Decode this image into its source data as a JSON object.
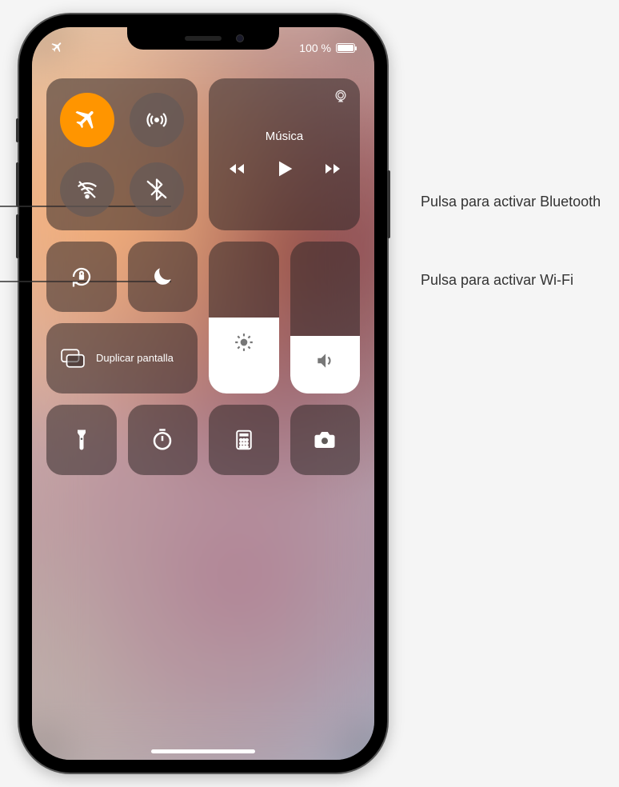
{
  "status": {
    "battery_pct": "100 %"
  },
  "connectivity": {
    "airplane": {
      "active": true
    },
    "cellular": {
      "active": false
    },
    "wifi": {
      "active": false
    },
    "bluetooth": {
      "active": false
    }
  },
  "music": {
    "title": "Música"
  },
  "mirror": {
    "label": "Duplicar pantalla"
  },
  "sliders": {
    "brightness_pct": 50,
    "volume_pct": 38
  },
  "callouts": {
    "bluetooth": "Pulsa para activar Bluetooth",
    "wifi": "Pulsa para activar Wi‑Fi"
  }
}
